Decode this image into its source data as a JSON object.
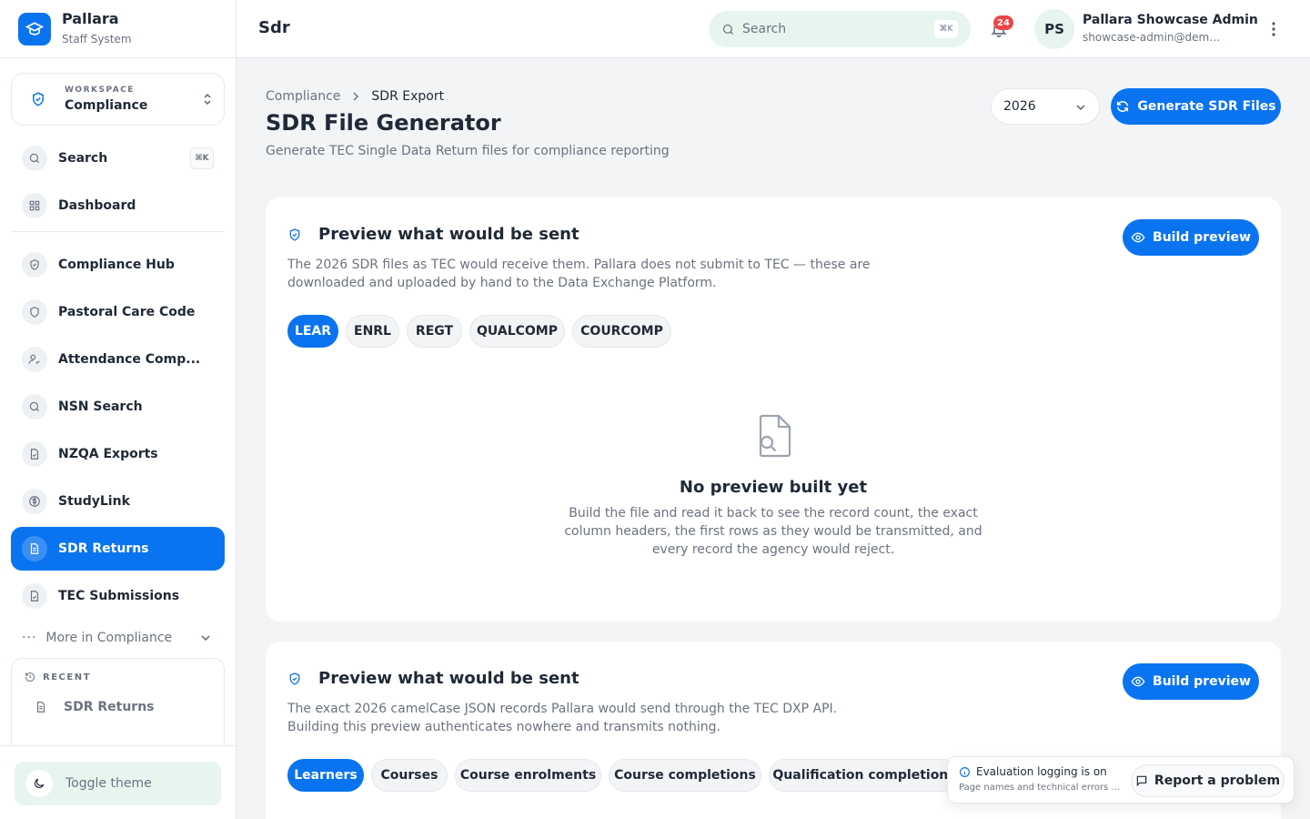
{
  "brand": {
    "name": "Pallara",
    "subtitle": "Staff System"
  },
  "workspace": {
    "label": "WORKSPACE",
    "name": "Compliance"
  },
  "sidebar": {
    "search_label": "Search",
    "search_shortcut": "⌘K",
    "dashboard_label": "Dashboard",
    "items": [
      {
        "label": "Compliance Hub",
        "icon": "shield-icon"
      },
      {
        "label": "Pastoral Care Code",
        "icon": "shield-outline-icon"
      },
      {
        "label": "Attendance Comp...",
        "icon": "user-check-icon"
      },
      {
        "label": "NSN Search",
        "icon": "search-icon"
      },
      {
        "label": "NZQA Exports",
        "icon": "file-check-icon"
      },
      {
        "label": "StudyLink",
        "icon": "dollar-icon"
      },
      {
        "label": "SDR Returns",
        "icon": "file-text-icon",
        "active": true
      },
      {
        "label": "TEC Submissions",
        "icon": "file-check-icon"
      }
    ],
    "more_label": "More in Compliance",
    "recent_label": "RECENT",
    "recent_items": [
      {
        "label": "SDR Returns"
      }
    ],
    "toggle_theme": "Toggle theme"
  },
  "header": {
    "title": "Sdr",
    "search_placeholder": "Search",
    "search_shortcut": "⌘K",
    "notification_count": "24",
    "user_initials": "PS",
    "user_name": "Pallara Showcase Admin",
    "user_email": "showcase-admin@demo.pallara.nz"
  },
  "page": {
    "breadcrumb": [
      "Compliance",
      "SDR Export"
    ],
    "title": "SDR File Generator",
    "subtitle": "Generate TEC Single Data Return files for compliance reporting",
    "year": "2026",
    "generate_button": "Generate SDR Files"
  },
  "cards": [
    {
      "title": "Preview what would be sent",
      "description": "The 2026 SDR files as TEC would receive them. Pallara does not submit to TEC — these are downloaded and uploaded by hand to the Data Exchange Platform.",
      "button": "Build preview",
      "tabs": [
        "LEAR",
        "ENRL",
        "REGT",
        "QUALCOMP",
        "COURCOMP"
      ],
      "empty_title": "No preview built yet",
      "empty_desc": "Build the file and read it back to see the record count, the exact column headers, the first rows as they would be transmitted, and every record the agency would reject."
    },
    {
      "title": "Preview what would be sent",
      "description": "The exact 2026 camelCase JSON records Pallara would send through the TEC DXP API. Building this preview authenticates nowhere and transmits nothing.",
      "button": "Build preview",
      "tabs": [
        "Learners",
        "Courses",
        "Course enrolments",
        "Course completions",
        "Qualification completions"
      ]
    }
  ],
  "toast": {
    "title": "Evaluation logging is on",
    "description": "Page names and technical errors are recorded",
    "report_button": "Report a problem"
  },
  "colors": {
    "accent": "#0a74f0",
    "badge": "#ef4444",
    "soft_green": "#e8f5ef"
  }
}
